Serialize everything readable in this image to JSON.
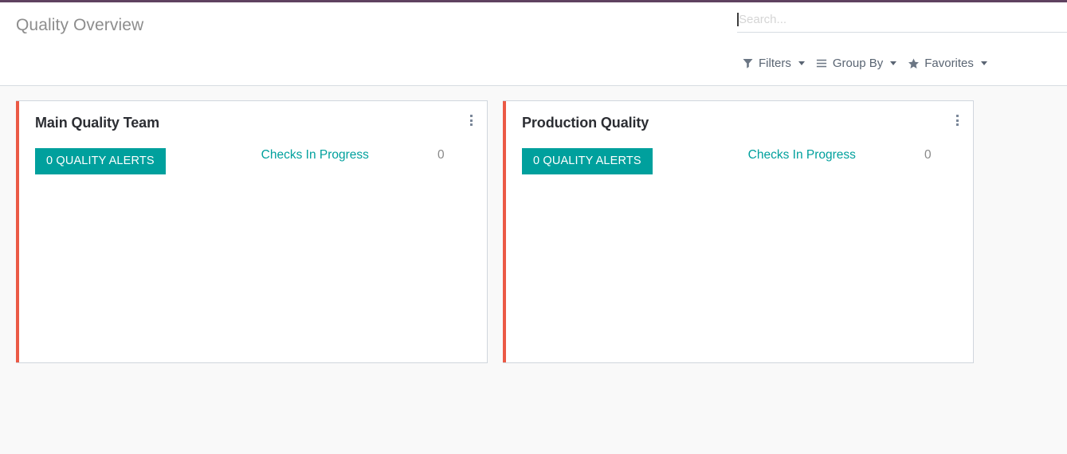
{
  "theme": {
    "accent_bar": "#5f4260",
    "card_stripe": "#eb5a46",
    "teal": "#00a09d",
    "page_background": "#f9f9f9"
  },
  "header": {
    "breadcrumb": "Quality Overview"
  },
  "search": {
    "placeholder": "Search...",
    "value": "",
    "icon": "text-cursor"
  },
  "controls": [
    {
      "label": "Filters",
      "icon": "filter-funnel-icon",
      "caret": true
    },
    {
      "label": "Group By",
      "icon": "hamburger-lines-icon",
      "caret": true
    },
    {
      "label": "Favorites",
      "icon": "star-icon",
      "caret": true
    }
  ],
  "cards": [
    {
      "title": "Main Quality Team",
      "alerts_label": "0 QUALITY ALERTS",
      "stat_label": "Checks In Progress",
      "stat_value": "0",
      "menu_icon": "vertical-ellipsis-icon"
    },
    {
      "title": "Production Quality",
      "alerts_label": "0 QUALITY ALERTS",
      "stat_label": "Checks In Progress",
      "stat_value": "0",
      "menu_icon": "vertical-ellipsis-icon"
    }
  ]
}
